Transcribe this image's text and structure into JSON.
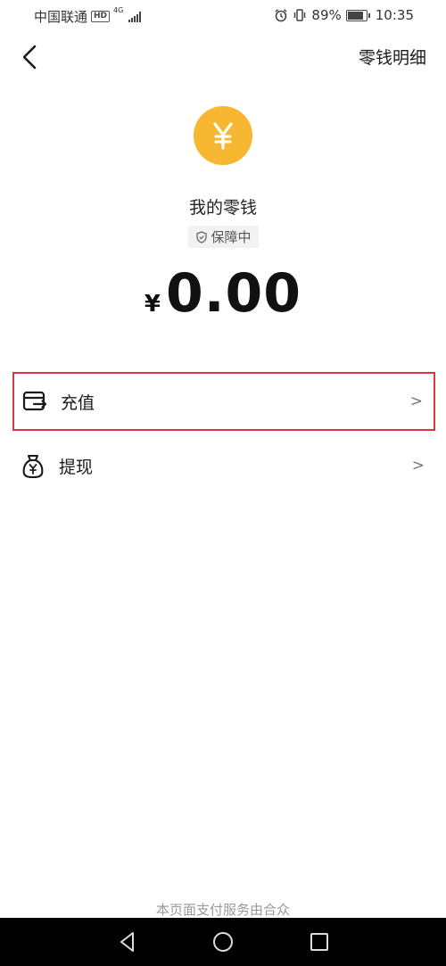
{
  "status_bar": {
    "carrier": "中国联通",
    "hd": "HD",
    "network": "4G",
    "battery_pct": "89%",
    "battery_level": 0.89,
    "time": "10:35"
  },
  "nav": {
    "back_icon": "chevron-left-icon",
    "detail_label": "零钱明细"
  },
  "wallet": {
    "coin_icon": "yen-coin-icon",
    "coin_symbol": "¥",
    "title": "我的零钱",
    "protection_badge": "保障中",
    "currency_symbol": "¥",
    "balance": "0.00"
  },
  "menu": [
    {
      "label": "充值",
      "icon": "recharge-card-icon",
      "chevron": ">"
    },
    {
      "label": "提现",
      "icon": "money-bag-icon",
      "chevron": ">"
    }
  ],
  "footer": {
    "note": "本页面支付服务由合众"
  },
  "colors": {
    "accent": "#f7b731",
    "highlight_border": "#d9363e",
    "badge_bg": "#f2f2f2"
  }
}
